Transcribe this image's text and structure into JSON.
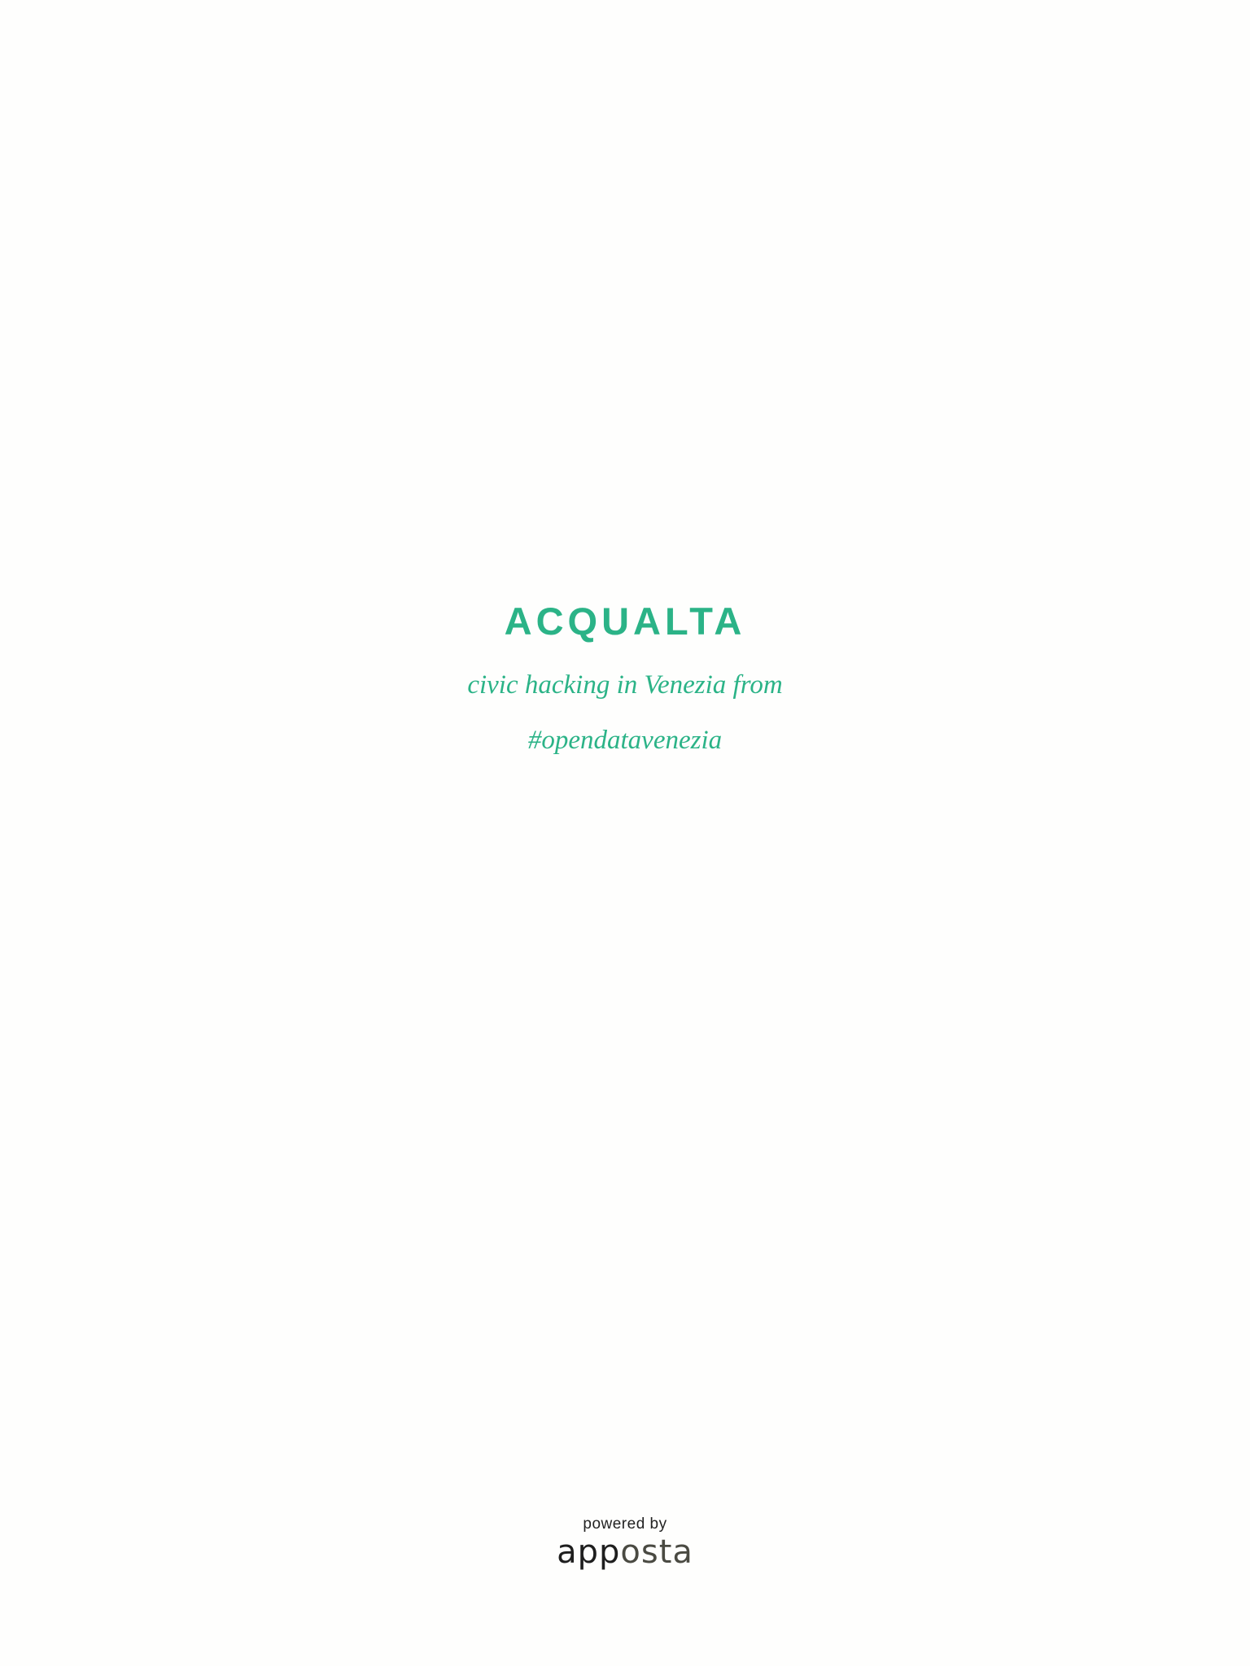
{
  "splash": {
    "title": "ACQUALTA",
    "tagline_line1": "civic hacking in Venezia from",
    "tagline_line2": "#opendatavenezia"
  },
  "footer": {
    "powered_by": "powered by",
    "brand_part_1": "app",
    "brand_part_2": "osta"
  },
  "colors": {
    "accent": "#2bb387",
    "background": "#fefefd",
    "brand_dark": "#1e1e1e",
    "brand_gray": "#4a4a42"
  }
}
